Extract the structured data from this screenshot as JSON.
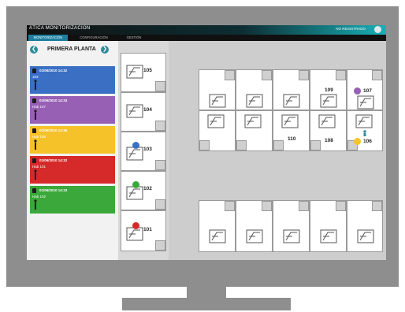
{
  "app": {
    "title": "ÁTICA MONITORIZACIÓN",
    "user_label": "NO REGISTRADO"
  },
  "tabs": [
    {
      "label": "MONITORIZACIÓN"
    },
    {
      "label": "CONFIGURACIÓN"
    },
    {
      "label": "GESTIÓN"
    }
  ],
  "sidebar": {
    "floor_title": "PRIMERA PLANTA",
    "alarms": [
      {
        "date": "01/06/2010 14:32",
        "room": "103",
        "color": "#3a6fc4"
      },
      {
        "date": "01/06/2010 14:33",
        "room": "Hab 107",
        "color": "#9760b5"
      },
      {
        "date": "01/06/2010 14:36",
        "room": "Hab 106",
        "color": "#f6c22a"
      },
      {
        "date": "01/06/2010 14:32",
        "room": "Hab 101",
        "color": "#d62a2a"
      },
      {
        "date": "01/06/2010 14:33",
        "room": "Hab 102",
        "color": "#3aa83a"
      }
    ]
  },
  "side_rooms": [
    {
      "number": "105",
      "status_color": ""
    },
    {
      "number": "104",
      "status_color": ""
    },
    {
      "number": "103",
      "status_color": "#3a6fc4"
    },
    {
      "number": "102",
      "status_color": "#3aa83a"
    },
    {
      "number": "101",
      "status_color": "#d62a2a"
    }
  ],
  "plan_rooms": {
    "r109": "109",
    "r107": "107",
    "r110": "110",
    "r108": "108",
    "r106": "106"
  },
  "colors": {
    "accent": "#1d7fa0",
    "blue": "#3a6fc4",
    "purple": "#9760b5",
    "yellow": "#f6c22a",
    "red": "#d62a2a",
    "green": "#3aa83a"
  }
}
